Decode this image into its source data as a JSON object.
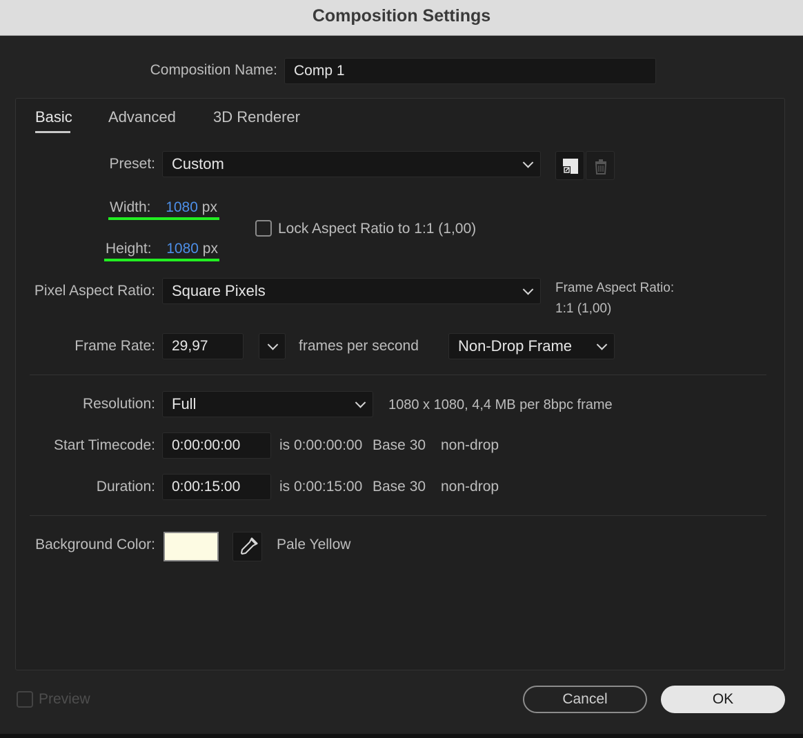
{
  "window": {
    "title": "Composition Settings"
  },
  "composition_name": {
    "label": "Composition Name:",
    "value": "Comp 1"
  },
  "tabs": [
    {
      "label": "Basic",
      "active": true
    },
    {
      "label": "Advanced",
      "active": false
    },
    {
      "label": "3D Renderer",
      "active": false
    }
  ],
  "preset": {
    "label": "Preset:",
    "value": "Custom"
  },
  "width": {
    "label": "Width:",
    "value": "1080",
    "unit": "px"
  },
  "height": {
    "label": "Height:",
    "value": "1080",
    "unit": "px"
  },
  "lock_aspect": {
    "label": "Lock Aspect Ratio to 1:1 (1,00)",
    "checked": false
  },
  "pixel_aspect": {
    "label": "Pixel Aspect Ratio:",
    "value": "Square Pixels"
  },
  "frame_aspect": {
    "label": "Frame Aspect Ratio:",
    "value": "1:1 (1,00)"
  },
  "frame_rate": {
    "label": "Frame Rate:",
    "value": "29,97",
    "suffix": "frames per second",
    "drop_mode": "Non-Drop Frame"
  },
  "resolution": {
    "label": "Resolution:",
    "value": "Full",
    "info": "1080 x 1080, 4,4 MB per 8bpc frame"
  },
  "start_timecode": {
    "label": "Start Timecode:",
    "value": "0:00:00:00",
    "is_text": "is 0:00:00:00",
    "base": "Base 30",
    "mode": "non-drop"
  },
  "duration": {
    "label": "Duration:",
    "value": "0:00:15:00",
    "is_text": "is 0:00:15:00",
    "base": "Base 30",
    "mode": "non-drop"
  },
  "background": {
    "label": "Background Color:",
    "color": "#fdfbe3",
    "name": "Pale Yellow"
  },
  "footer": {
    "preview_label": "Preview",
    "cancel_label": "Cancel",
    "ok_label": "OK"
  },
  "colors": {
    "highlight_underline": "#22ee22",
    "value_blue": "#4d8fe8"
  }
}
